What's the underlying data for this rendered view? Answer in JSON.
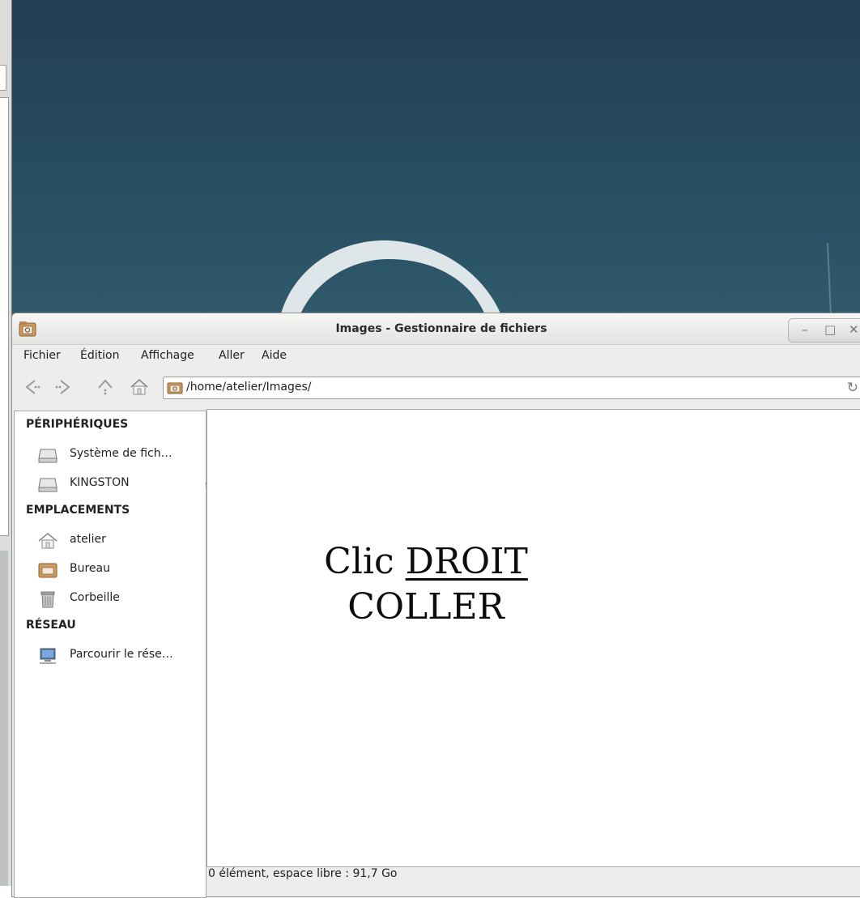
{
  "window": {
    "title": "Images - Gestionnaire de fichiers",
    "controls": [
      "minimize-icon",
      "maximize-icon",
      "close-icon"
    ]
  },
  "menubar": {
    "items": [
      {
        "label": "Fichier"
      },
      {
        "label": "Édition"
      },
      {
        "label": "Affichage"
      },
      {
        "label": "Aller"
      },
      {
        "label": "Aide"
      }
    ]
  },
  "toolbar": {
    "icons": [
      "back-icon",
      "forward-icon",
      "parent-folder-icon",
      "home-icon"
    ],
    "location_path": "/home/atelier/Images/"
  },
  "sidebar": {
    "devices_header": "PÉRIPHÉRIQUES",
    "devices": [
      {
        "label": "Système de fich…",
        "icon": "drive-icon"
      },
      {
        "label": "KINGSTON",
        "icon": "drive-icon",
        "eject": true
      }
    ],
    "places_header": "EMPLACEMENTS",
    "places": [
      {
        "label": "atelier",
        "icon": "home-icon"
      },
      {
        "label": "Bureau",
        "icon": "desktop-folder-icon"
      },
      {
        "label": "Corbeille",
        "icon": "trash-icon"
      }
    ],
    "network_header": "RÉSEAU",
    "network": [
      {
        "label": "Parcourir le rése…",
        "icon": "network-icon"
      }
    ]
  },
  "overlay": {
    "line1_prefix": "Clic",
    "line1_emphasis": "DROIT",
    "line2": "COLLER"
  },
  "statusbar": {
    "text": "0 élément, espace libre : 91,7 Go"
  }
}
